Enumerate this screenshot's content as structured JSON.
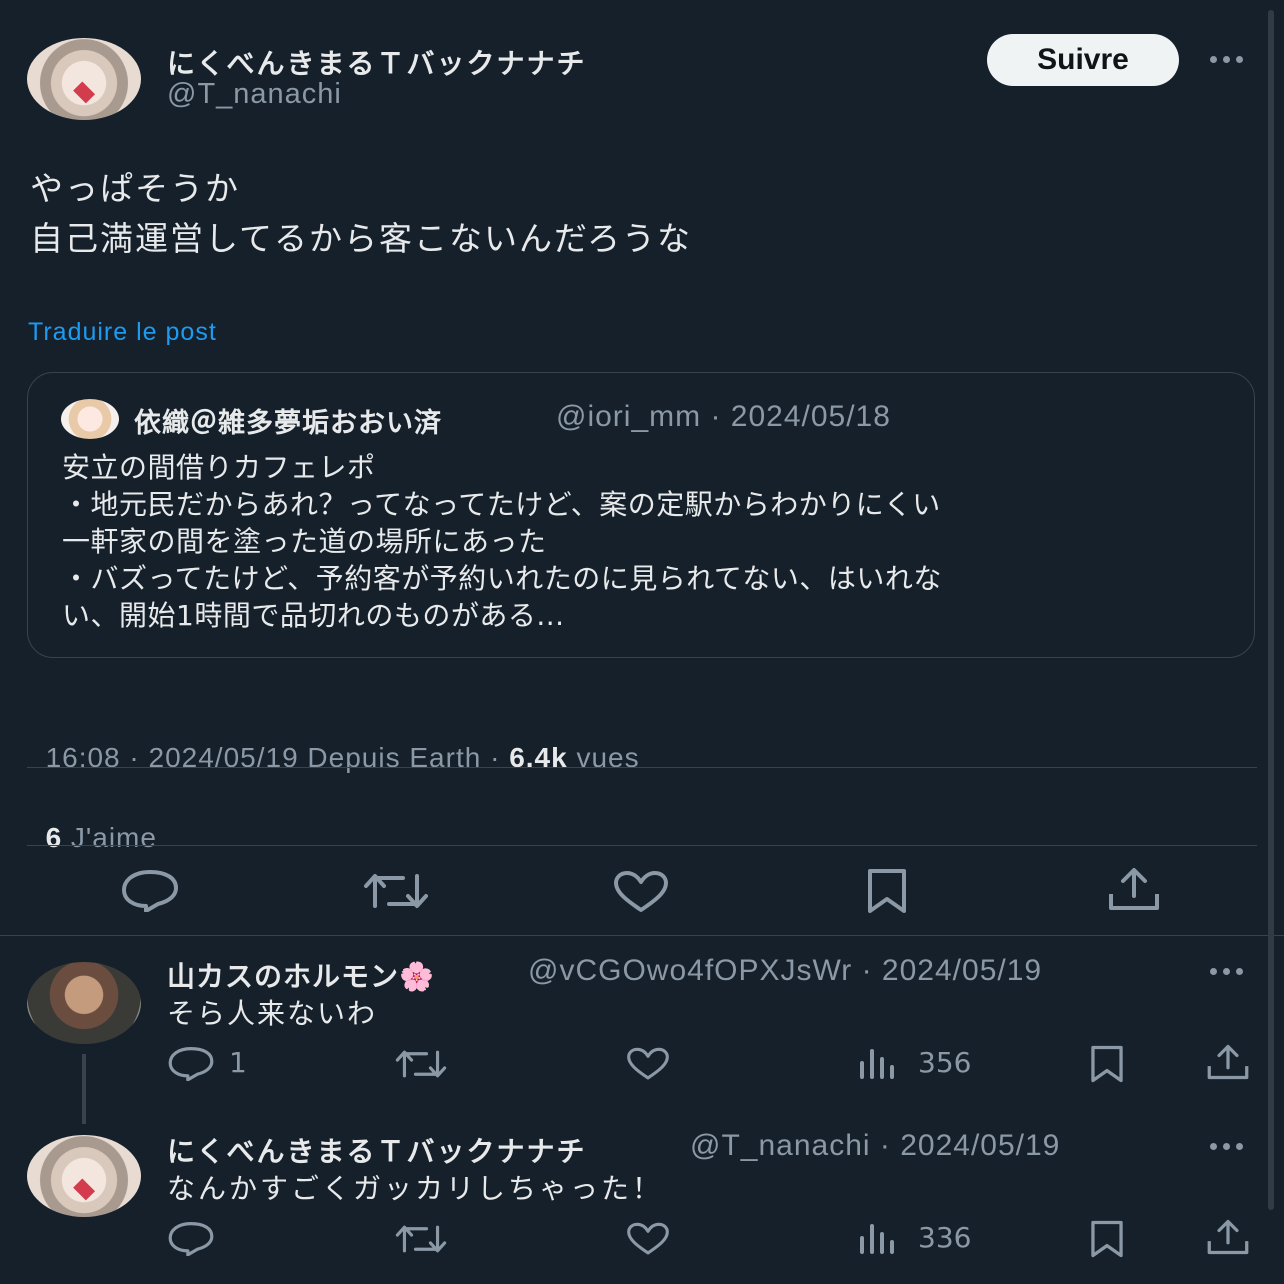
{
  "main_tweet": {
    "display_name": "にくべんきまるＴバックナナチ",
    "handle": "@T_nanachi",
    "follow_label": "Suivre",
    "lines": [
      "やっぱそうか",
      "自己満運営してるから客こないんだろうな"
    ],
    "translate_label": "Traduire le post",
    "timestamp": "16:08 · 2024/05/19 Depuis Earth · ",
    "views_count": "6.4k",
    "views_label": " vues",
    "likes_count": "6",
    "likes_label": " J'aime"
  },
  "quoted": {
    "display_name": "依織＠雑多夢垢おおい済",
    "handle_date": "@iori_mm · 2024/05/18",
    "lines": [
      "安立の間借りカフェレポ",
      "・地元民だからあれ？ってなってたけど、案の定駅からわかりにくい",
      "一軒家の間を塗った道の場所にあった",
      "・バズってたけど、予約客が予約いれたのに見られてない、はいれな",
      "い、開始1時間で品切れのものがある..."
    ]
  },
  "replies": [
    {
      "display_name": "山カスのホルモン🌸",
      "handle_date": "@vCGOwo4fOPXJsWr · 2024/05/19",
      "text": "そら人来ないわ",
      "reply_count": "1",
      "views": "356"
    },
    {
      "display_name": "にくべんきまるＴバックナナチ",
      "handle_date": "@T_nanachi · 2024/05/19",
      "text": "なんかすごくガッカリしちゃった！",
      "reply_count": "",
      "views": "336"
    }
  ],
  "colors": {
    "background": "#15202b",
    "text": "#e7e9ea",
    "muted": "#8b98a5",
    "link": "#1d9bf0",
    "border": "#38444d"
  },
  "icons": [
    "reply-icon",
    "retweet-icon",
    "like-icon",
    "bookmark-icon",
    "share-icon",
    "views-icon",
    "more-icon"
  ]
}
